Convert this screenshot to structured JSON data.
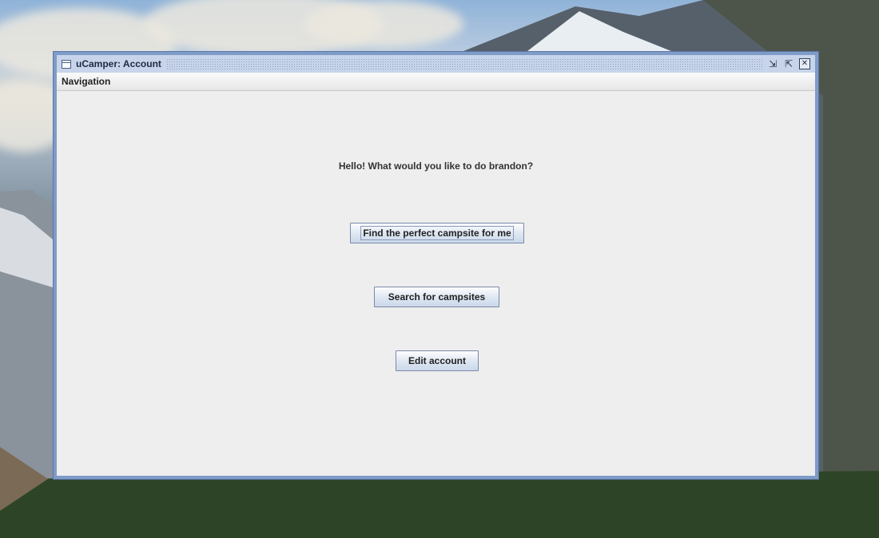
{
  "window": {
    "title": "uCamper: Account",
    "controls": {
      "minimize_icon": "minimize-icon",
      "maximize_icon": "maximize-icon",
      "close_icon": "close-icon"
    }
  },
  "menubar": {
    "items": [
      {
        "label": "Navigation"
      }
    ]
  },
  "main": {
    "greeting": "Hello! What would you like to do brandon?",
    "buttons": [
      {
        "label": "Find the perfect campsite for me",
        "focused": true
      },
      {
        "label": "Search for campsites",
        "focused": false
      },
      {
        "label": "Edit account",
        "focused": false
      }
    ]
  },
  "colors": {
    "window_frame": "#7f9cc8",
    "titlebar": "#c7d4ea",
    "panel": "#eeeeee",
    "button_gradient_end": "#cbd8ea"
  }
}
